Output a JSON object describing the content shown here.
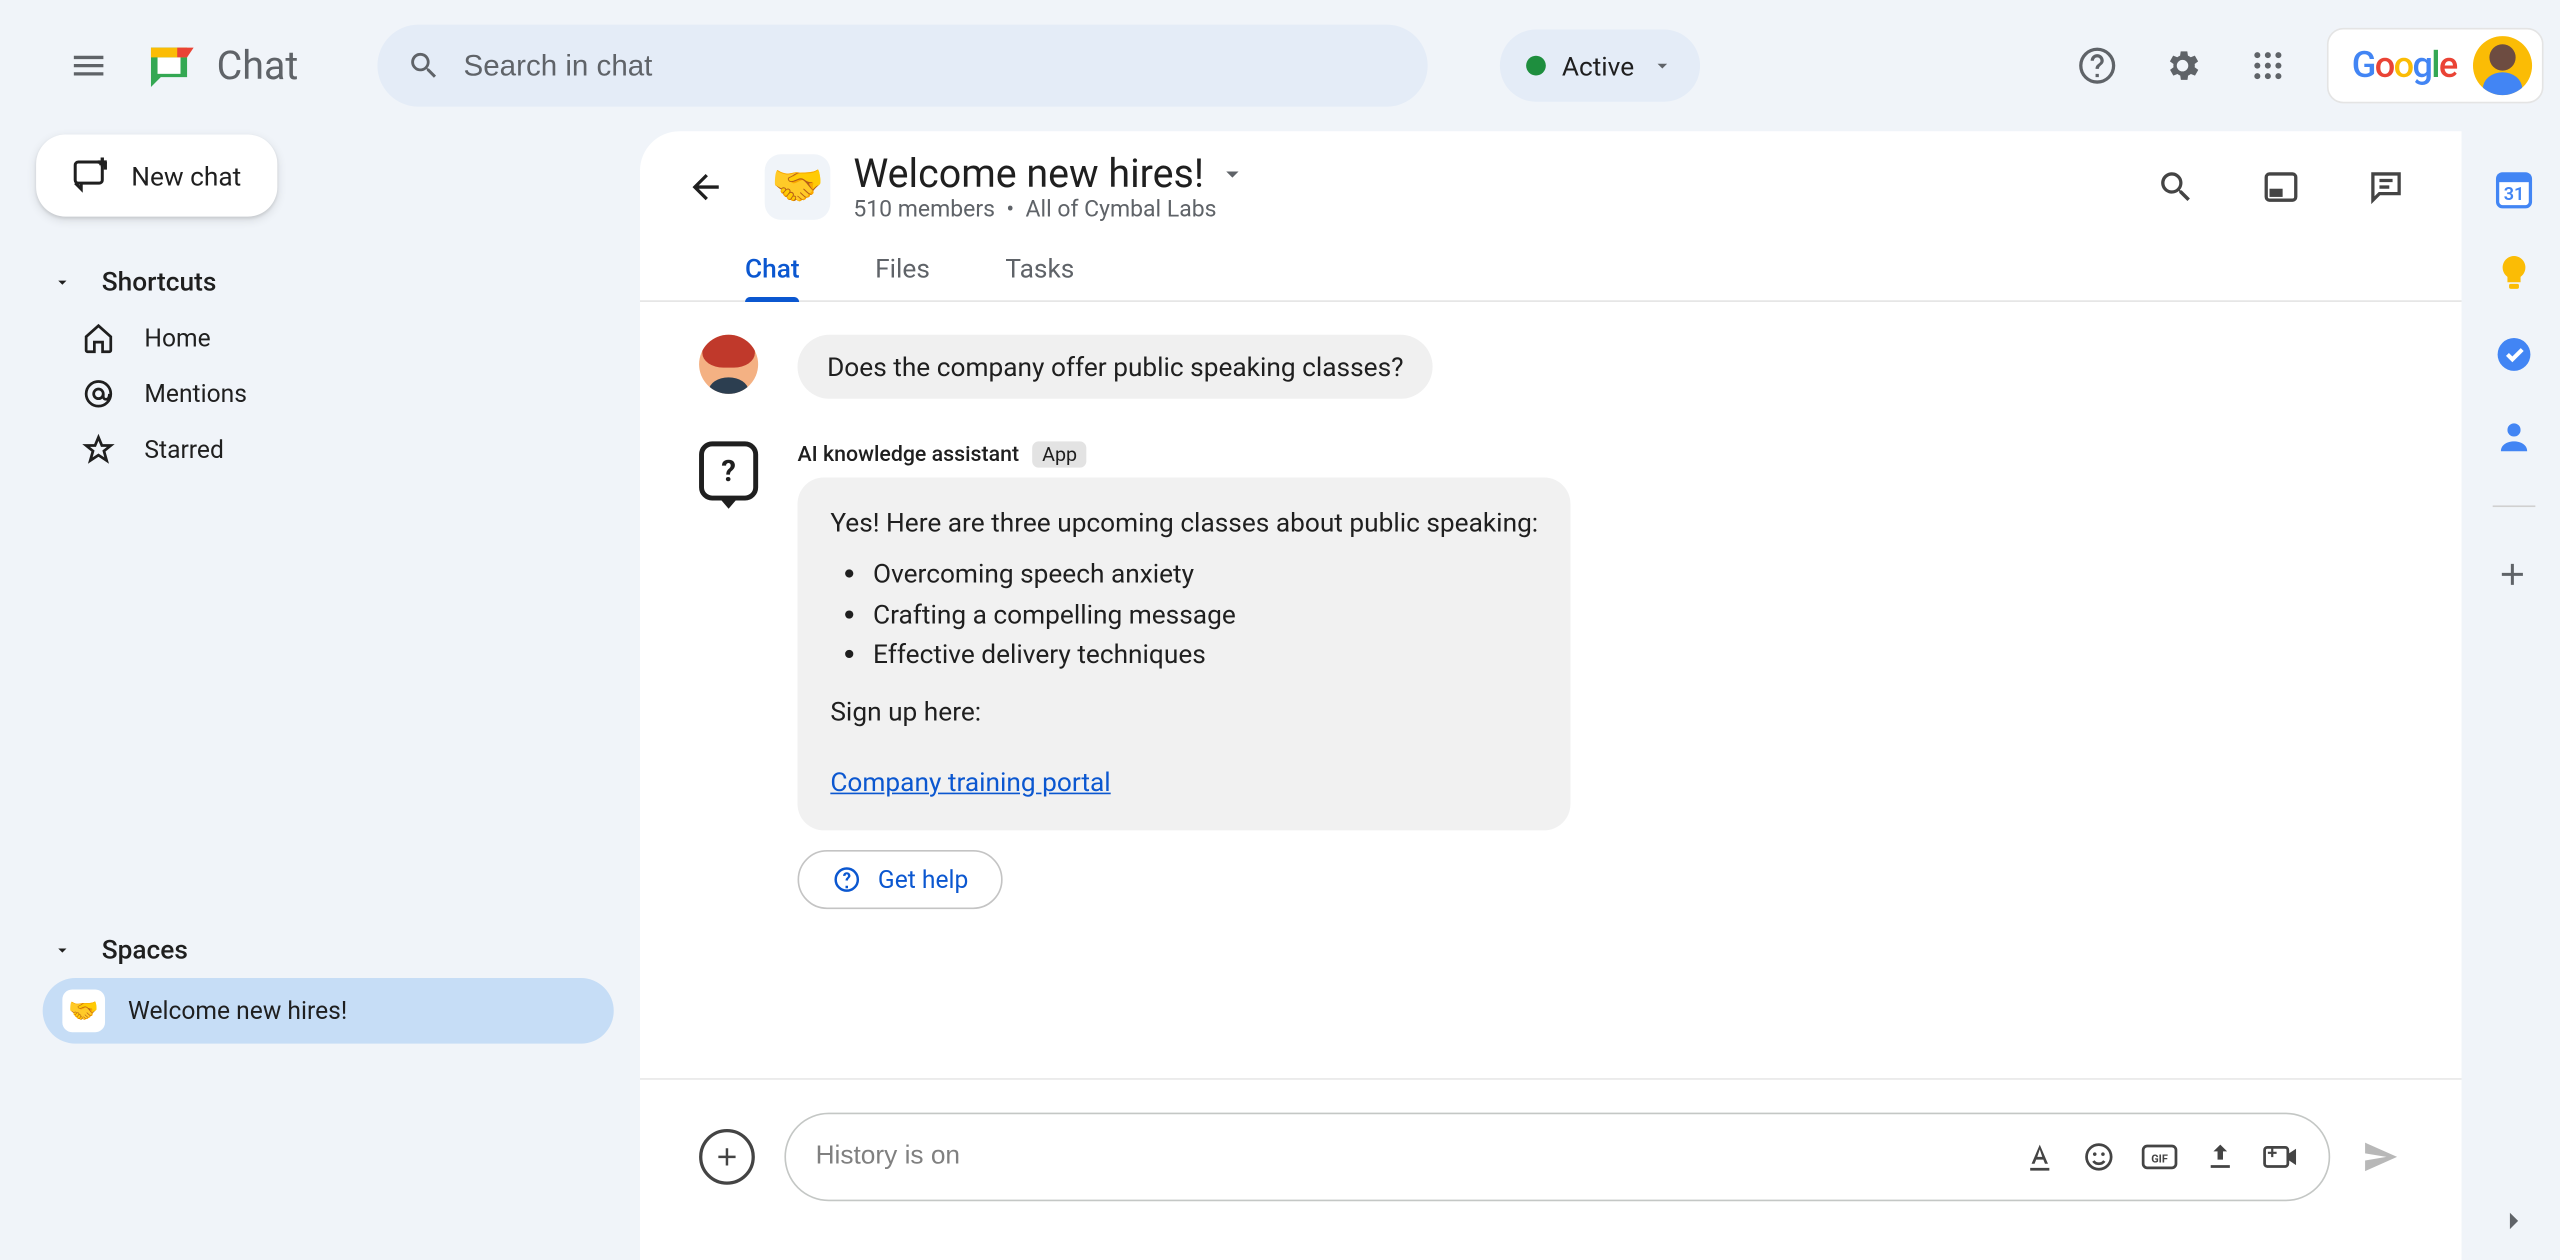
{
  "topbar": {
    "app_name": "Chat",
    "search_placeholder": "Search in chat",
    "status_label": "Active"
  },
  "sidebar": {
    "new_chat_label": "New chat",
    "shortcuts_header": "Shortcuts",
    "shortcuts": [
      {
        "id": "home",
        "label": "Home"
      },
      {
        "id": "mentions",
        "label": "Mentions"
      },
      {
        "id": "starred",
        "label": "Starred"
      }
    ],
    "spaces_header": "Spaces",
    "spaces": [
      {
        "id": "welcome-new-hires",
        "label": "Welcome new hires!",
        "emoji": "🤝",
        "active": true
      }
    ]
  },
  "chat_header": {
    "emoji": "🤝",
    "title": "Welcome new hires!",
    "member_count": "510 members",
    "scope": "All of Cymbal Labs"
  },
  "tabs": [
    {
      "id": "chat",
      "label": "Chat",
      "active": true
    },
    {
      "id": "files",
      "label": "Files",
      "active": false
    },
    {
      "id": "tasks",
      "label": "Tasks",
      "active": false
    }
  ],
  "messages": {
    "user_question": "Does the company offer public speaking classes?",
    "bot": {
      "sender_name": "AI knowledge assistant",
      "badge": "App",
      "intro": "Yes! Here are three upcoming classes about public speaking:",
      "items": [
        "Overcoming speech anxiety",
        "Crafting a compelling message",
        "Effective delivery techniques"
      ],
      "signup_text": "Sign up here:",
      "link_text": "Company training portal",
      "get_help_label": "Get help"
    }
  },
  "composer": {
    "placeholder": "History is on"
  }
}
